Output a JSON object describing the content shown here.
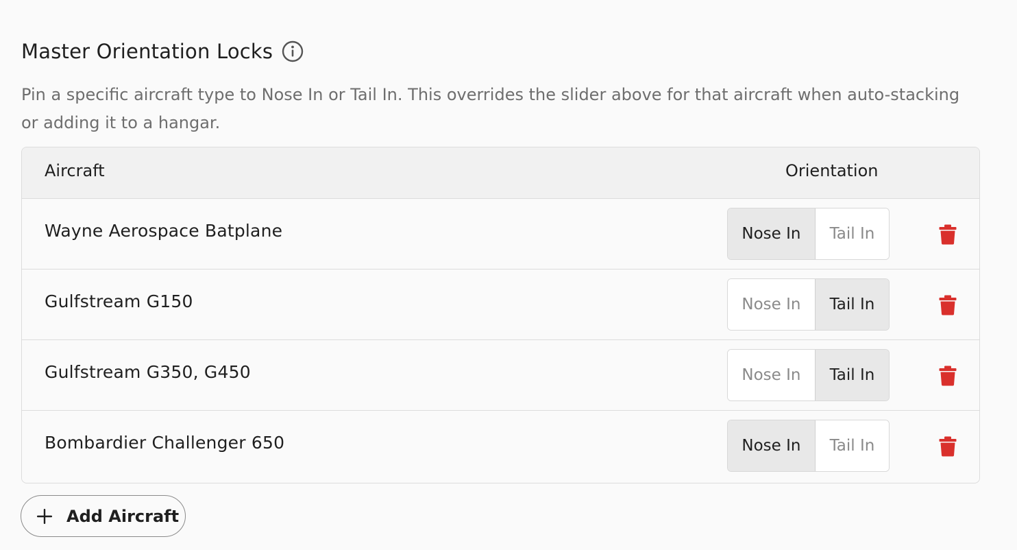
{
  "section": {
    "title": "Master Orientation Locks",
    "info_icon": "info-circle-icon",
    "description": "Pin a specific aircraft type to Nose In or Tail In. This overrides the slider above for that aircraft when auto-stacking or adding it to a hangar."
  },
  "table": {
    "headers": {
      "aircraft": "Aircraft",
      "orientation": "Orientation"
    },
    "rows": [
      {
        "aircraft": "Wayne Aerospace Batplane",
        "nose_label": "Nose In",
        "tail_label": "Tail In",
        "selected": "nose"
      },
      {
        "aircraft": "Gulfstream G150",
        "nose_label": "Nose In",
        "tail_label": "Tail In",
        "selected": "tail"
      },
      {
        "aircraft": "Gulfstream G350, G450",
        "nose_label": "Nose In",
        "tail_label": "Tail In",
        "selected": "tail"
      },
      {
        "aircraft": "Bombardier Challenger 650",
        "nose_label": "Nose In",
        "tail_label": "Tail In",
        "selected": "nose"
      }
    ],
    "delete_icon": "trash-icon",
    "delete_color": "#d9302c"
  },
  "add_button": {
    "label": "Add Aircraft",
    "icon": "plus-icon"
  }
}
